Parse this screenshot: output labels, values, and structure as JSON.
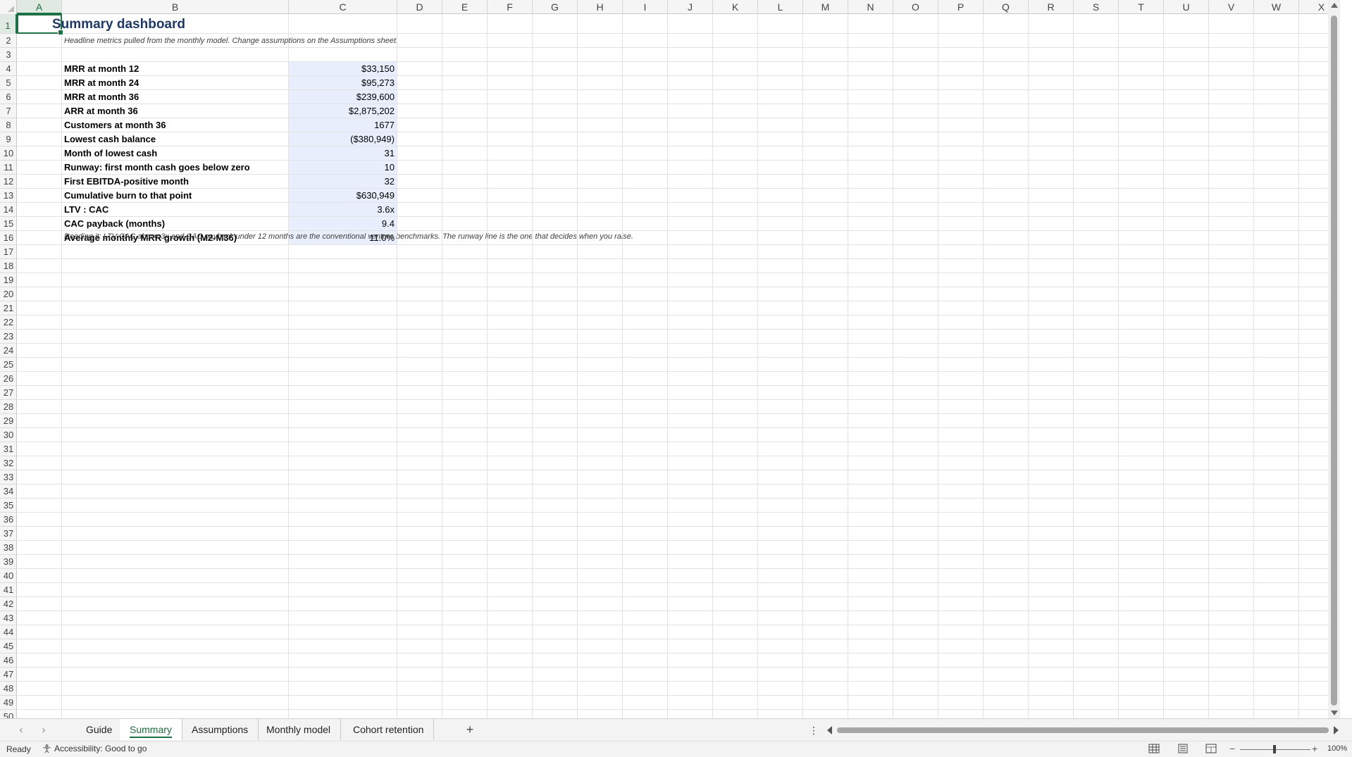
{
  "columns": [
    "A",
    "B",
    "C",
    "D",
    "E",
    "F",
    "G",
    "H",
    "I",
    "J",
    "K",
    "L",
    "M",
    "N",
    "O",
    "P",
    "Q",
    "R",
    "S",
    "T",
    "U",
    "V",
    "W",
    "X"
  ],
  "active_column": "A",
  "active_row": 1,
  "sheet": {
    "title": "Summary dashboard",
    "subtitle": "Headline metrics pulled from the monthly model. Change assumptions on the Assumptions sheet.",
    "metrics": [
      {
        "label": "MRR at month 12",
        "value": "$33,150"
      },
      {
        "label": "MRR at month 24",
        "value": "$95,273"
      },
      {
        "label": "MRR at month 36",
        "value": "$239,600"
      },
      {
        "label": "ARR at month 36",
        "value": "$2,875,202"
      },
      {
        "label": "Customers at month 36",
        "value": "1677"
      },
      {
        "label": "Lowest cash balance",
        "value": "($380,949)"
      },
      {
        "label": "Month of lowest cash",
        "value": "31"
      },
      {
        "label": "Runway: first month cash goes below zero",
        "value": "10"
      },
      {
        "label": "First EBITDA-positive month",
        "value": "32"
      },
      {
        "label": "Cumulative burn to that point",
        "value": "$630,949"
      },
      {
        "label": "LTV : CAC",
        "value": "3.6x"
      },
      {
        "label": "CAC payback (months)",
        "value": "9.4"
      },
      {
        "label": "Average monthly MRR growth (M2-M36)",
        "value": "11.0%"
      }
    ],
    "footnote": "Reading it: LTV:CAC above 3x and CAC payback under 12 months are the conventional venture benchmarks. The runway line is the one that decides when you raise."
  },
  "tabs": [
    {
      "label": "Guide",
      "active": false
    },
    {
      "label": "Summary",
      "active": true
    },
    {
      "label": "Assumptions",
      "active": false
    },
    {
      "label": "Monthly model",
      "active": false
    },
    {
      "label": "Cohort retention",
      "active": false
    }
  ],
  "tab_nav": {
    "prev": "‹",
    "next": "›",
    "add": "+",
    "more": "⋮"
  },
  "status": {
    "ready": "Ready",
    "accessibility": "Accessibility: Good to go",
    "zoom": "100%",
    "zoom_minus": "−",
    "zoom_plus": "+"
  },
  "colors": {
    "accent": "#1e7145",
    "title": "#1f3864",
    "value_fill": "#e8eefb"
  }
}
